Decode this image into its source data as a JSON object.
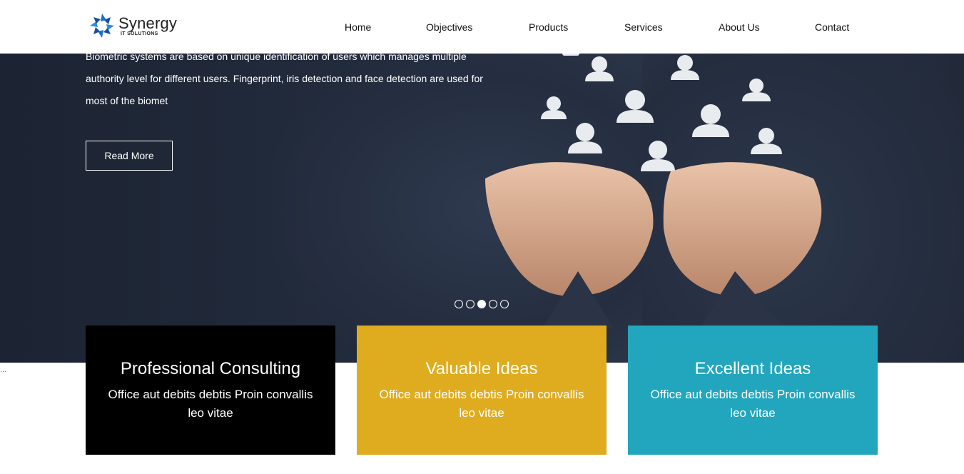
{
  "header": {
    "logo": {
      "name": "Synergy",
      "tagline": "IT SOLUTIONS"
    },
    "nav": [
      "Home",
      "Objectives",
      "Products",
      "Services",
      "About Us",
      "Contact"
    ]
  },
  "hero": {
    "text": "Biometric systems are based on unique identification of users which manages multiple authority level for different users. Fingerprint, iris detection and face detection are used for most of the biomet",
    "button_label": "Read More",
    "slides_total": 5,
    "active_slide": 3
  },
  "cards": [
    {
      "title": "Professional Consulting",
      "text": "Office aut debits debtis Proin convallis leo vitae",
      "color": "#000000"
    },
    {
      "title": "Valuable Ideas",
      "text": "Office aut debits debtis Proin convallis leo vitae",
      "color": "#dfac20"
    },
    {
      "title": "Excellent Ideas",
      "text": "Office aut debits debtis Proin convallis leo vitae",
      "color": "#22a6bd"
    }
  ],
  "misc": {
    "ellipsis": "..."
  }
}
